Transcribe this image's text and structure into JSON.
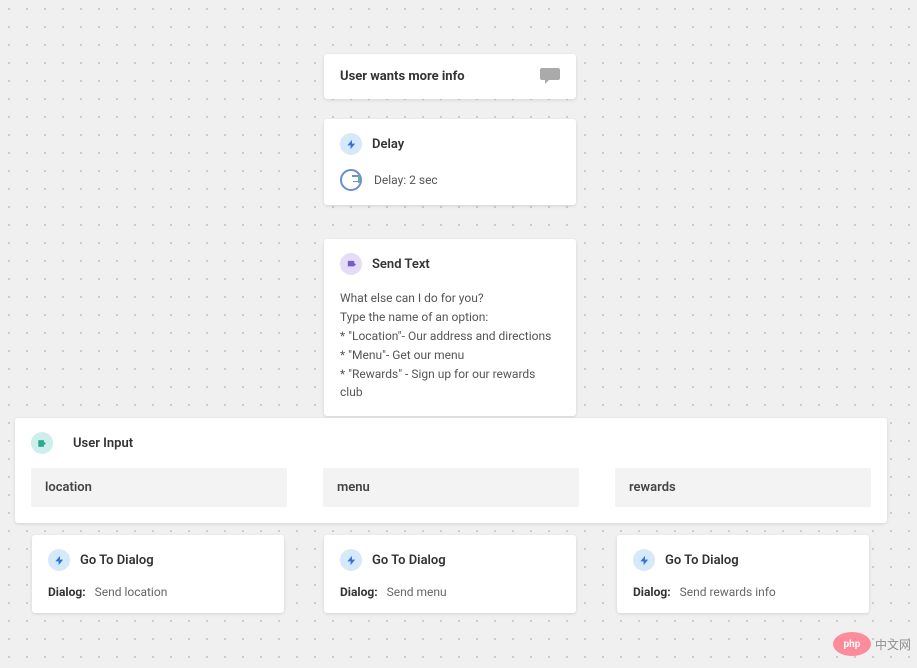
{
  "trigger": {
    "title": "User wants more info"
  },
  "delay": {
    "title": "Delay",
    "value": "Delay: 2 sec"
  },
  "sendText": {
    "title": "Send Text",
    "lines": [
      "What else can I do for you?",
      "Type the name of an option:",
      "* \"Location\"- Our address and directions",
      "* \"Menu\"- Get our menu",
      "* \"Rewards\" - Sign up for our rewards club"
    ]
  },
  "userInput": {
    "title": "User Input",
    "options": [
      "location",
      "menu",
      "rewards"
    ]
  },
  "goto": {
    "title": "Go To Dialog",
    "label": "Dialog:",
    "targets": [
      "Send location",
      "Send menu",
      "Send rewards info"
    ]
  },
  "watermark": {
    "badge": "php",
    "text": "中文网"
  }
}
